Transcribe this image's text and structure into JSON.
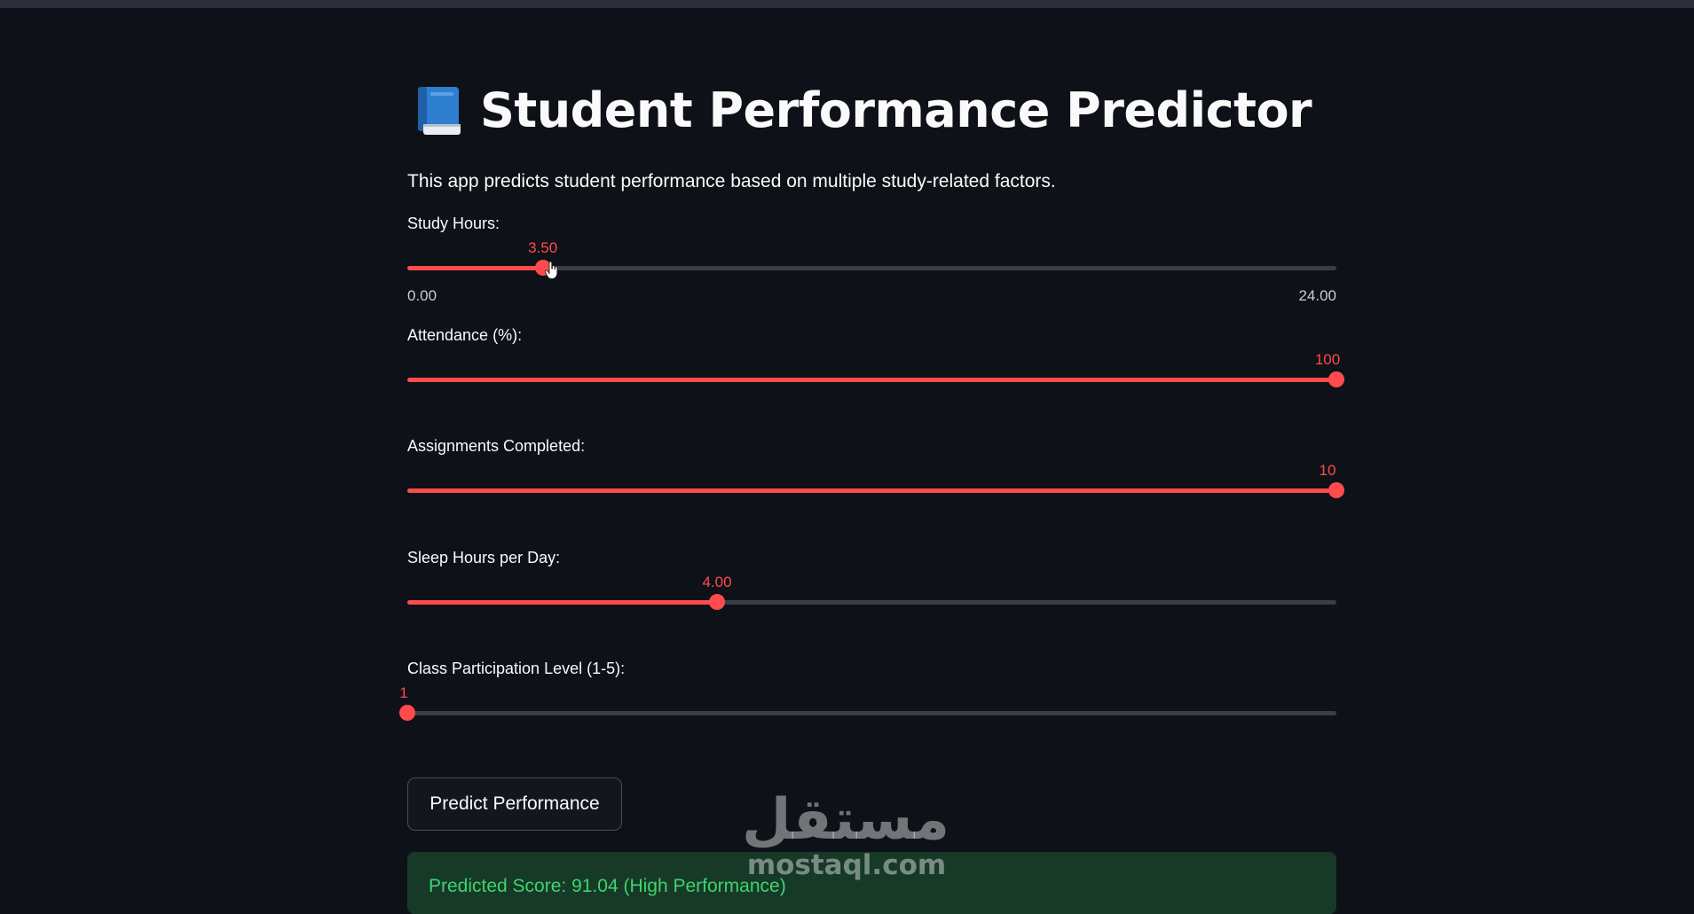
{
  "app": {
    "title": "Student Performance Predictor",
    "description": "This app predicts student performance based on multiple study-related factors.",
    "icon": "blue-book-icon"
  },
  "sliders": [
    {
      "label": "Study Hours:",
      "value": 3.5,
      "value_text": "3.50",
      "min": 0,
      "max": 24,
      "min_text": "0.00",
      "max_text": "24.00",
      "show_range": true
    },
    {
      "label": "Attendance (%):",
      "value": 100,
      "value_text": "100",
      "min": 0,
      "max": 100,
      "show_range": false
    },
    {
      "label": "Assignments Completed:",
      "value": 10,
      "value_text": "10",
      "min": 0,
      "max": 10,
      "show_range": false
    },
    {
      "label": "Sleep Hours per Day:",
      "value": 4,
      "value_text": "4.00",
      "min": 0,
      "max": 12,
      "show_range": false
    },
    {
      "label": "Class Participation Level (1-5):",
      "value": 1,
      "value_text": "1",
      "min": 1,
      "max": 5,
      "show_range": false
    }
  ],
  "button": {
    "label": "Predict Performance"
  },
  "result": {
    "text": "Predicted Score: 91.04 (High Performance)"
  },
  "watermark": {
    "arabic": "مستقل",
    "latin": "mostaql.com"
  },
  "colors": {
    "background": "#0e1117",
    "accent": "#ff4b4b",
    "track": "#3a3d45",
    "success_bg": "#173928",
    "success_text": "#3dd56d"
  }
}
